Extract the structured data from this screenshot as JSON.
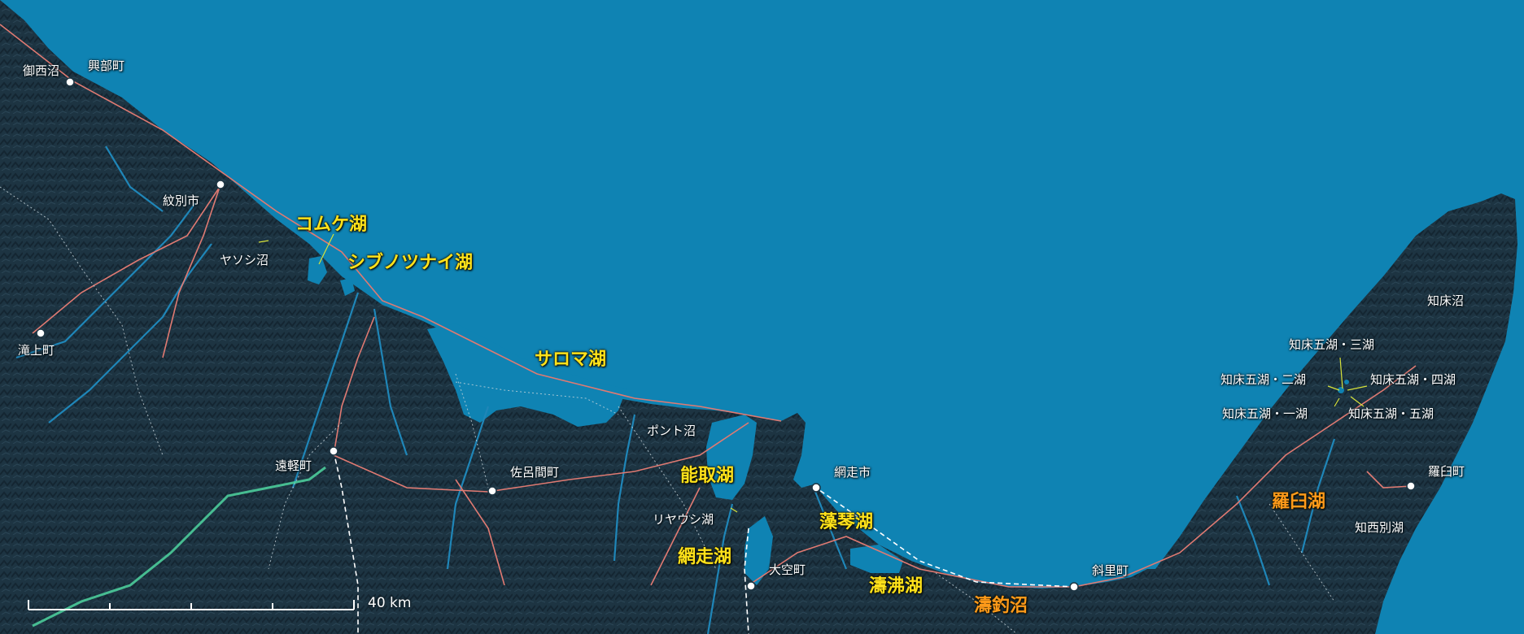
{
  "colors": {
    "sea": "#0f83b3",
    "land": "#1d3442",
    "land_shade": "#142632",
    "river": "#1f86b8",
    "road": "#e07a72",
    "boundary": "#c9d6dc",
    "highlight_lake_label": "#ffe21a",
    "orange_lake_label": "#ff9a1a",
    "trail": "#4fd6a0"
  },
  "towns": {
    "okoppe": "興部町",
    "monbetsu": "紋別市",
    "takinoue": "滝上町",
    "engaru": "遠軽町",
    "saroma": "佐呂間町",
    "abashiri": "網走市",
    "ozora": "大空町",
    "shari": "斜里町",
    "rausu": "羅臼町"
  },
  "small_lakes": {
    "onishibetsu": "御西沼",
    "yasoshi": "ヤソシ沼",
    "ponto": "ポント沼",
    "riyaushi": "リヤウシ湖",
    "shiretoko_numa": "知床沼",
    "goko_3": "知床五湖・三湖",
    "goko_2": "知床五湖・二湖",
    "goko_4": "知床五湖・四湖",
    "goko_1": "知床五湖・一湖",
    "goko_5": "知床五湖・五湖",
    "chinishibetsu": "知西別湖"
  },
  "major_lakes": {
    "komuke": "コムケ湖",
    "shibunotsunai": "シブノツナイ湖",
    "saroma": "サロマ湖",
    "notoro": "能取湖",
    "abashiri": "網走湖",
    "mokoto": "藻琴湖",
    "tofutsu": "濤沸湖",
    "totsuri": "濤釣沼",
    "rausu": "羅臼湖"
  },
  "scale_bar": {
    "label": "40 km",
    "distance_km": 40
  }
}
